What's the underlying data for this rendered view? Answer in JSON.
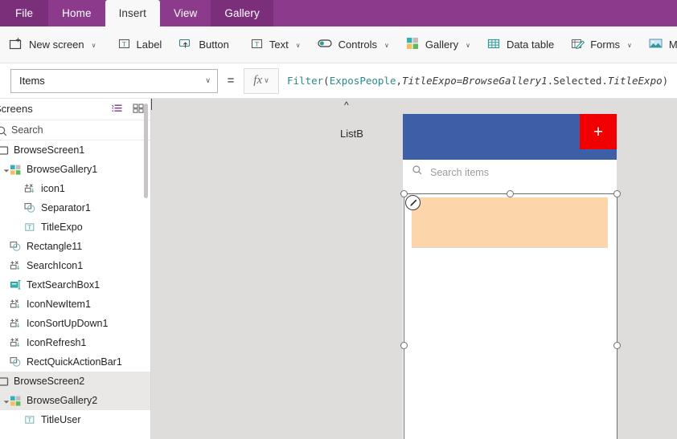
{
  "tabs": [
    {
      "label": "File",
      "state": "file"
    },
    {
      "label": "Home",
      "state": "normal"
    },
    {
      "label": "Insert",
      "state": "active"
    },
    {
      "label": "View",
      "state": "normal"
    },
    {
      "label": "Gallery",
      "state": "contextual"
    }
  ],
  "ribbon": {
    "items": [
      {
        "label": "New screen",
        "icon": "new-screen-icon",
        "caret": true
      },
      {
        "label": "Label",
        "icon": "label-icon",
        "caret": false
      },
      {
        "label": "Button",
        "icon": "button-icon",
        "caret": false
      },
      {
        "label": "Text",
        "icon": "text-icon",
        "caret": true
      },
      {
        "label": "Controls",
        "icon": "controls-icon",
        "caret": true
      },
      {
        "label": "Gallery",
        "icon": "gallery-icon",
        "caret": true
      },
      {
        "label": "Data table",
        "icon": "data-table-icon",
        "caret": false
      },
      {
        "label": "Forms",
        "icon": "forms-icon",
        "caret": true
      },
      {
        "label": "Media",
        "icon": "media-icon",
        "caret": true
      }
    ],
    "caret_glyph": "∨"
  },
  "property_bar": {
    "selected_property": "Items",
    "equals": "=",
    "fx_label": "fx",
    "formula_tokens": [
      {
        "text": "Filter",
        "kind": "fn"
      },
      {
        "text": "(",
        "kind": "pun"
      },
      {
        "text": "ExposPeople",
        "kind": "fn"
      },
      {
        "text": ", ",
        "kind": "pun"
      },
      {
        "text": "TitleExpo",
        "kind": "id"
      },
      {
        "text": " = ",
        "kind": "pun"
      },
      {
        "text": "BrowseGallery1",
        "kind": "id"
      },
      {
        "text": ".Selected.",
        "kind": "pl"
      },
      {
        "text": "TitleExpo",
        "kind": "id"
      },
      {
        "text": ")",
        "kind": "pun"
      }
    ],
    "formula_plain": "Filter(ExposPeople, TitleExpo = BrowseGallery1.Selected.TitleExpo)"
  },
  "tree_panel": {
    "title": "Screens",
    "search_placeholder": "Search",
    "view_icons": [
      {
        "name": "tree-view-icon",
        "active": true
      },
      {
        "name": "thumbnail-view-icon",
        "active": false
      }
    ],
    "nodes": [
      {
        "label": "BrowseScreen1",
        "icon": "screen-icon",
        "depth": 0,
        "twisty": "collapsed",
        "selected": false
      },
      {
        "label": "BrowseGallery1",
        "icon": "gallery-icon",
        "depth": 1,
        "twisty": "expanded",
        "selected": false
      },
      {
        "label": "icon1",
        "icon": "icon-shape-icon",
        "depth": 2,
        "twisty": "none",
        "selected": false
      },
      {
        "label": "Separator1",
        "icon": "shape-icon",
        "depth": 2,
        "twisty": "none",
        "selected": false
      },
      {
        "label": "TitleExpo",
        "icon": "label-icon",
        "depth": 2,
        "twisty": "none",
        "selected": false
      },
      {
        "label": "Rectangle11",
        "icon": "shape-icon",
        "depth": 1,
        "twisty": "none",
        "selected": false
      },
      {
        "label": "SearchIcon1",
        "icon": "icon-shape-icon",
        "depth": 1,
        "twisty": "none",
        "selected": false
      },
      {
        "label": "TextSearchBox1",
        "icon": "textbox-icon",
        "depth": 1,
        "twisty": "none",
        "selected": false
      },
      {
        "label": "IconNewItem1",
        "icon": "icon-shape-icon",
        "depth": 1,
        "twisty": "none",
        "selected": false
      },
      {
        "label": "IconSortUpDown1",
        "icon": "icon-shape-icon",
        "depth": 1,
        "twisty": "none",
        "selected": false
      },
      {
        "label": "IconRefresh1",
        "icon": "icon-shape-icon",
        "depth": 1,
        "twisty": "none",
        "selected": false
      },
      {
        "label": "RectQuickActionBar1",
        "icon": "shape-icon",
        "depth": 1,
        "twisty": "none",
        "selected": false
      },
      {
        "label": "BrowseScreen2",
        "icon": "screen-icon",
        "depth": 0,
        "twisty": "collapsed",
        "selected": true
      },
      {
        "label": "BrowseGallery2",
        "icon": "gallery-icon",
        "depth": 1,
        "twisty": "expanded",
        "selected": true
      },
      {
        "label": "TitleUser",
        "icon": "label-icon",
        "depth": 2,
        "twisty": "none",
        "selected": false
      }
    ]
  },
  "canvas": {
    "annotation": {
      "caret": "^",
      "label": "ListB"
    },
    "phone": {
      "header_color": "#3c5fa8",
      "new_button_glyph": "+",
      "new_button_color": "#f00000",
      "search_placeholder": "Search items",
      "gallery_item_color": "#fcd5ab"
    },
    "selection": {
      "edit_icon": "pencil-icon"
    }
  },
  "colors": {
    "brand_purple": "#8c3a8c",
    "brand_purple_dark": "#7b2f7b",
    "canvas_bg": "#dedddc",
    "accent_blue": "#3c5fa8",
    "accent_red": "#f00000",
    "accent_orange": "#fcd5ab"
  }
}
